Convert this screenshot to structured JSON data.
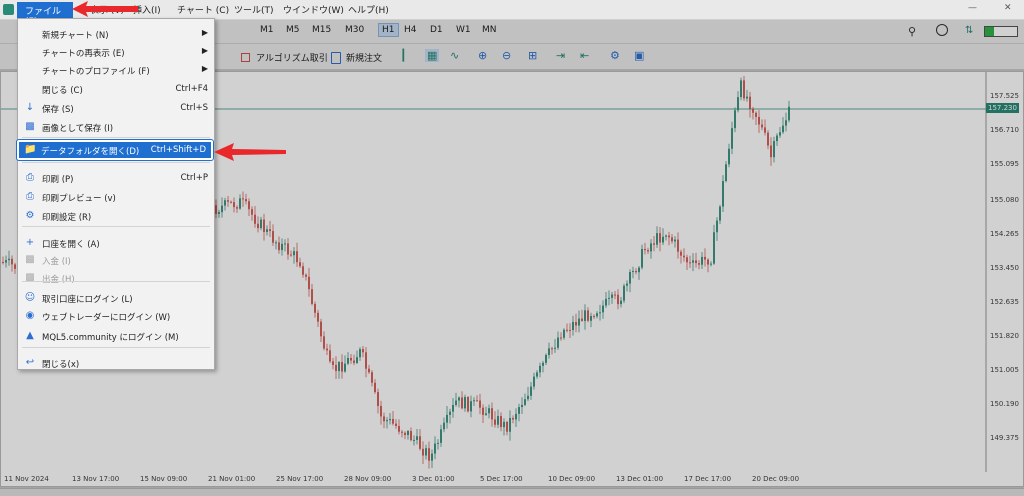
{
  "menubar": {
    "file": "ファイル (F)",
    "view": "表示 (V)",
    "insert": "挿入(I)",
    "chart": "チャート (C)",
    "tools": "ツール(T)",
    "window": "ウインドウ(W)",
    "help": "ヘルプ(H)",
    "minimize": "—",
    "close": "✕"
  },
  "toolbar": {
    "timeframes": [
      "M1",
      "M5",
      "M15",
      "M30",
      "H1",
      "H4",
      "D1",
      "W1",
      "MN"
    ],
    "active_timeframe": "H1",
    "algo_trading": "アルゴリズム取引",
    "new_order": "新規注文"
  },
  "file_menu": {
    "items": [
      {
        "label": "新規チャート (N)",
        "shortcut": "",
        "submenu": true,
        "icon": "none"
      },
      {
        "label": "チャートの再表示 (E)",
        "shortcut": "",
        "submenu": true,
        "icon": "none"
      },
      {
        "label": "チャートのプロファイル (F)",
        "shortcut": "",
        "submenu": true,
        "icon": "none"
      },
      {
        "label": "閉じる (C)",
        "shortcut": "Ctrl+F4",
        "submenu": false,
        "icon": "none"
      },
      {
        "label": "保存 (S)",
        "shortcut": "Ctrl+S",
        "submenu": false,
        "icon": "save-icon"
      },
      {
        "label": "画像として保存 (I)",
        "shortcut": "",
        "submenu": false,
        "icon": "image-icon"
      },
      {
        "label": "データフォルダを開く(D)",
        "shortcut": "Ctrl+Shift+D",
        "submenu": false,
        "icon": "folder-icon",
        "highlighted": true
      },
      {
        "label": "印刷 (P)",
        "shortcut": "Ctrl+P",
        "submenu": false,
        "icon": "print-icon"
      },
      {
        "label": "印刷プレビュー (v)",
        "shortcut": "",
        "submenu": false,
        "icon": "print-preview-icon"
      },
      {
        "label": "印刷設定 (R)",
        "shortcut": "",
        "submenu": false,
        "icon": "print-settings-icon"
      },
      {
        "label": "口座を開く (A)",
        "shortcut": "",
        "submenu": false,
        "icon": "plus-icon"
      },
      {
        "label": "入金 (I)",
        "shortcut": "",
        "submenu": false,
        "icon": "deposit-icon",
        "disabled": true
      },
      {
        "label": "出金 (H)",
        "shortcut": "",
        "submenu": false,
        "icon": "withdraw-icon",
        "disabled": true
      },
      {
        "label": "取引口座にログイン (L)",
        "shortcut": "",
        "submenu": false,
        "icon": "user-icon"
      },
      {
        "label": "ウェブトレーダーにログイン (W)",
        "shortcut": "",
        "submenu": false,
        "icon": "globe-icon"
      },
      {
        "label": "MQL5.community にログイン (M)",
        "shortcut": "",
        "submenu": false,
        "icon": "graduation-cap-icon"
      },
      {
        "label": "閉じる(x)",
        "shortcut": "",
        "submenu": false,
        "icon": "exit-icon"
      }
    ]
  },
  "chart": {
    "current_price": "157.230",
    "y_labels": [
      "157.525",
      "156.710",
      "155.095",
      "155.080",
      "154.265",
      "153.450",
      "152.635",
      "151.820",
      "151.005",
      "150.190",
      "149.375"
    ],
    "x_labels": [
      "11 Nov 2024",
      "13 Nov 17:00",
      "15 Nov 09:00",
      "21 Nov 01:00",
      "25 Nov 17:00",
      "28 Nov 09:00",
      "3 Dec 01:00",
      "5 Dec 17:00",
      "10 Dec 09:00",
      "13 Dec 01:00",
      "17 Dec 17:00",
      "20 Dec 09:00"
    ],
    "colors": {
      "up": "#2a8a78",
      "down": "#d0504a",
      "price_line": "#2a8a78"
    }
  },
  "colors": {
    "accent": "#1f6fd1",
    "annotation_arrow": "#e8282b"
  }
}
